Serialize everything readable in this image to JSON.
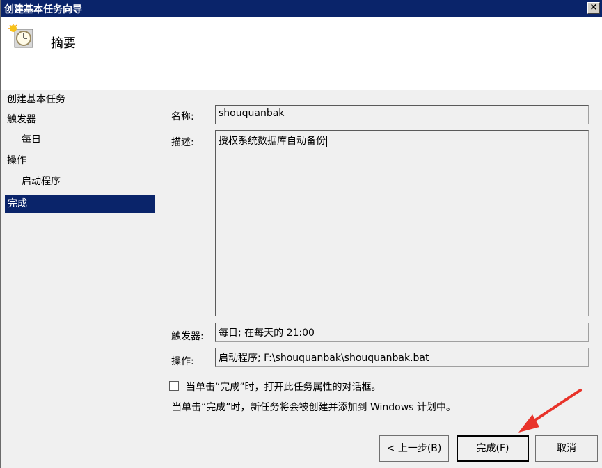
{
  "window": {
    "title": "创建基本任务向导",
    "close_glyph": "×"
  },
  "header": {
    "title": "摘要",
    "icon": "scheduled-task-clock-icon"
  },
  "sidebar": {
    "items": [
      {
        "label": "创建基本任务",
        "active": false
      },
      {
        "label": "触发器",
        "active": false
      },
      {
        "label": "每日",
        "active": false
      },
      {
        "label": "操作",
        "active": false
      },
      {
        "label": "启动程序",
        "active": false
      },
      {
        "label": "完成",
        "active": true
      }
    ]
  },
  "form": {
    "name_label": "名称:",
    "name_value": "shouquanbak",
    "description_label": "描述:",
    "description_value": "授权系统数据库自动备份",
    "trigger_label": "触发器:",
    "trigger_value": "每日; 在每天的 21:00",
    "action_label": "操作:",
    "action_value": "启动程序; F:\\shouquanbak\\shouquanbak.bat"
  },
  "options": {
    "open_properties_label": "当单击“完成”时，打开此任务属性的对话框。",
    "open_properties_checked": false,
    "info_text": "当单击“完成”时，新任务将会被创建并添加到 Windows 计划中。"
  },
  "buttons": {
    "back": "< 上一步(B)",
    "finish": "完成(F)",
    "cancel": "取消"
  },
  "colors": {
    "title_bar": "#0a246a",
    "selection": "#0a246a",
    "annotation_arrow": "#e8332a"
  }
}
